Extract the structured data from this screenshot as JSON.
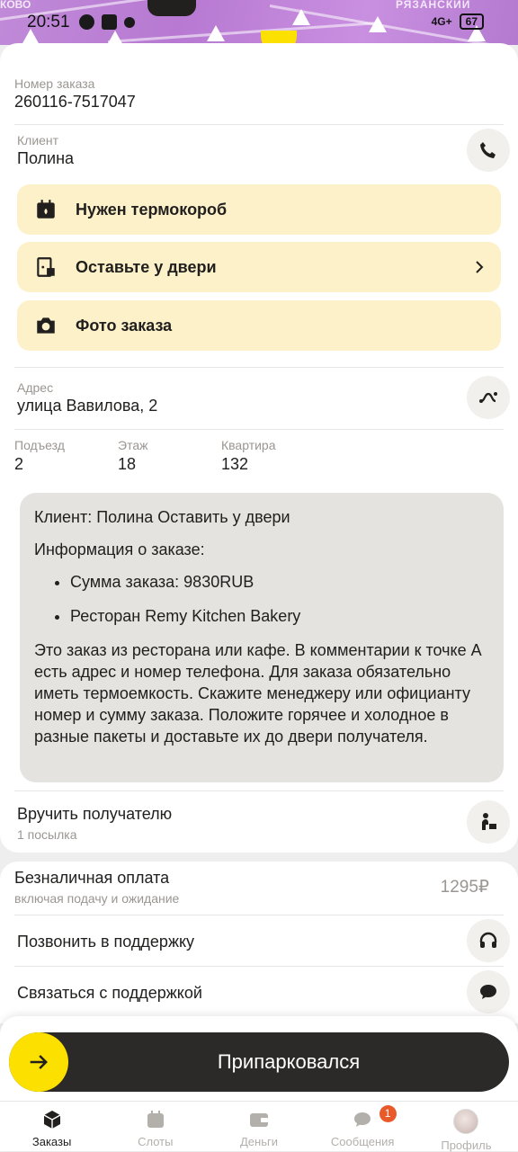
{
  "status_bar": {
    "time": "20:51",
    "network": "4G+",
    "battery": "67",
    "map_district": "РЯЗАНСКИЙ",
    "map_district_left": "КОВО"
  },
  "order": {
    "number_label": "Номер заказа",
    "number": "260116-7517047"
  },
  "client": {
    "label": "Клиент",
    "name": "Полина",
    "call_icon": "phone-icon"
  },
  "cards": [
    {
      "icon": "thermobox-icon",
      "label": "Нужен термокороб"
    },
    {
      "icon": "door-icon",
      "label": "Оставьте у двери"
    },
    {
      "icon": "camera-icon",
      "label": "Фото заказа"
    }
  ],
  "address": {
    "label": "Адрес",
    "value": "улица Вавилова, 2"
  },
  "details": {
    "entrance_label": "Подъезд",
    "entrance": "2",
    "floor_label": "Этаж",
    "floor": "18",
    "apartment_label": "Квартира",
    "apartment": "132"
  },
  "comment": {
    "line1": "Клиент: Полина Оставить у двери",
    "line2": "Информация о заказе:",
    "bullet1": "Сумма заказа: 9830RUB",
    "bullet2": "Ресторан Remy Kitchen Bakery",
    "body": "Это заказ из ресторана или кафе. В комментарии к точке А есть адрес и номер телефона. Для заказа обязательно иметь термоемкость. Скажите менеджеру или официанту номер и сумму заказа. Положите горячее и холодное в разные пакеты и доставьте их до двери получателя."
  },
  "deliver": {
    "title": "Вручить получателю",
    "subtitle": "1 посылка"
  },
  "payment": {
    "title": "Безналичная оплата",
    "subtitle": "включая подачу и ожидание",
    "amount": "1295₽"
  },
  "support": {
    "call": "Позвонить в поддержку",
    "chat": "Связаться с поддержкой"
  },
  "action": {
    "label": "Припарковался"
  },
  "tabs": [
    {
      "label": "Заказы",
      "icon": "orders-icon",
      "active": true
    },
    {
      "label": "Слоты",
      "icon": "calendar-icon"
    },
    {
      "label": "Деньги",
      "icon": "wallet-icon"
    },
    {
      "label": "Сообщения",
      "icon": "chat-icon",
      "badge": "1"
    },
    {
      "label": "Профиль",
      "icon": "avatar"
    }
  ],
  "colors": {
    "accent": "#fce000",
    "card": "#fdf1c9",
    "comment_bg": "#e5e3df",
    "badge": "#e85a2a"
  }
}
